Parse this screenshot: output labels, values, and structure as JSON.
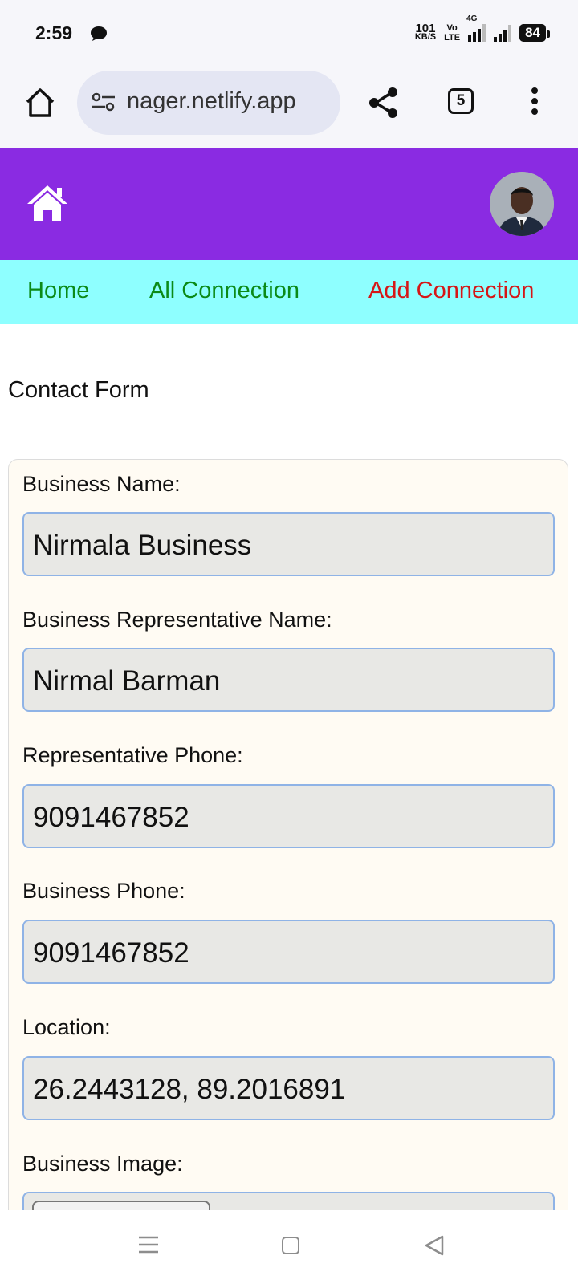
{
  "status_bar": {
    "time": "2:59",
    "net_speed_value": "101",
    "net_speed_unit": "KB/S",
    "volte_line1": "Vo",
    "volte_line2": "LTE",
    "network_type": "4G",
    "battery": "84"
  },
  "browser": {
    "url": "nager.netlify.app",
    "tab_count": "5",
    "icons": [
      "home-icon",
      "site-settings-icon",
      "share-icon",
      "tabs-icon",
      "more-vert-icon"
    ]
  },
  "app_header": {
    "icons": [
      "home-icon",
      "avatar"
    ],
    "colors": {
      "header_bg": "#8a2be2",
      "nav_bg": "#8effff",
      "link_green": "#0b8a17",
      "link_red": "#d61616"
    }
  },
  "nav": {
    "items": [
      {
        "label": "Home"
      },
      {
        "label": "All Connection"
      },
      {
        "label": "Add Connection"
      }
    ]
  },
  "main": {
    "title": "Contact Form",
    "fields": [
      {
        "label": "Business Name:",
        "value": "Nirmala Business"
      },
      {
        "label": "Business Representative Name:",
        "value": "Nirmal Barman"
      },
      {
        "label": "Representative Phone:",
        "value": "9091467852"
      },
      {
        "label": "Business Phone:",
        "value": "9091467852"
      },
      {
        "label": "Location:",
        "value": "26.2443128, 89.2016891"
      },
      {
        "label": "Business Image:"
      }
    ]
  }
}
